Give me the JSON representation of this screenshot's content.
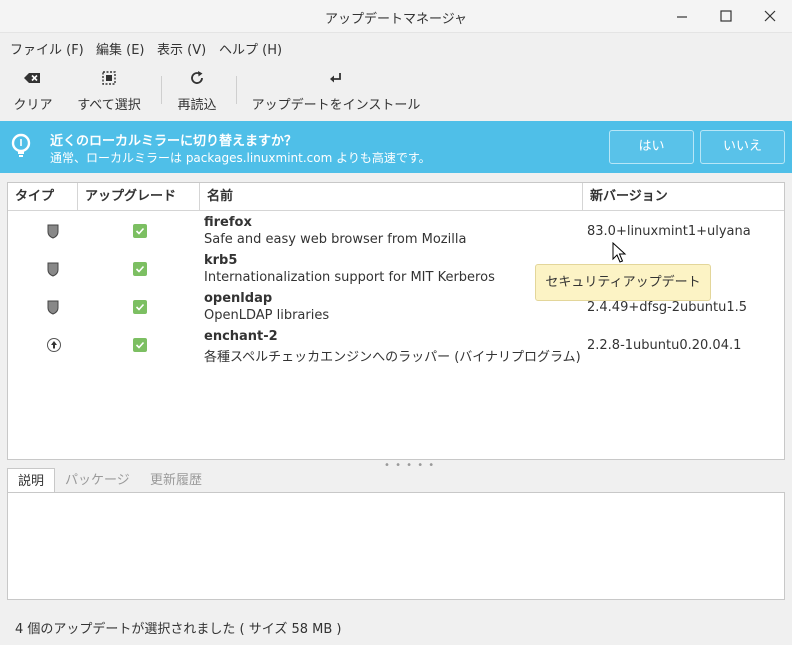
{
  "window": {
    "title": "アップデートマネージャ"
  },
  "menu": [
    "ファイル (F)",
    "編集 (E)",
    "表示 (V)",
    "ヘルプ (H)"
  ],
  "toolbar": {
    "clear": "クリア",
    "select_all": "すべて選択",
    "refresh": "再読込",
    "install": "アップデートをインストール"
  },
  "infobar": {
    "question": "近くのローカルミラーに切り替えますか？",
    "detail": "通常、ローカルミラーは packages.linuxmint.com よりも高速です。",
    "yes": "はい",
    "no": "いいえ"
  },
  "columns": [
    "タイプ",
    "アップグレード",
    "名前",
    "新バージョン"
  ],
  "updates": [
    {
      "type_icon": "shield-icon",
      "checked": true,
      "name": "firefox",
      "desc": "Safe and easy web browser from Mozilla",
      "version": "83.0+linuxmint1+ulyana"
    },
    {
      "type_icon": "shield-icon",
      "checked": true,
      "name": "krb5",
      "desc": "Internationalization support for MIT Kerberos",
      "version": ""
    },
    {
      "type_icon": "shield-icon",
      "checked": true,
      "name": "openldap",
      "desc": "OpenLDAP libraries",
      "version": "2.4.49+dfsg-2ubuntu1.5"
    },
    {
      "type_icon": "arrow-up-icon",
      "checked": true,
      "name": "enchant-2",
      "desc": "各種スペルチェッカエンジンへのラッパー (バイナリプログラム)",
      "version": "2.2.8-1ubuntu0.20.04.1"
    }
  ],
  "tooltip": "セキュリティアップデート",
  "tabs": [
    "説明",
    "パッケージ",
    "更新履歴"
  ],
  "status": "4 個のアップデートが選択されました ( サイズ 58 MB )",
  "colors": {
    "infobar": "#4fbfe8",
    "check": "#7cbf62",
    "tooltip": "#fcf3c5"
  }
}
